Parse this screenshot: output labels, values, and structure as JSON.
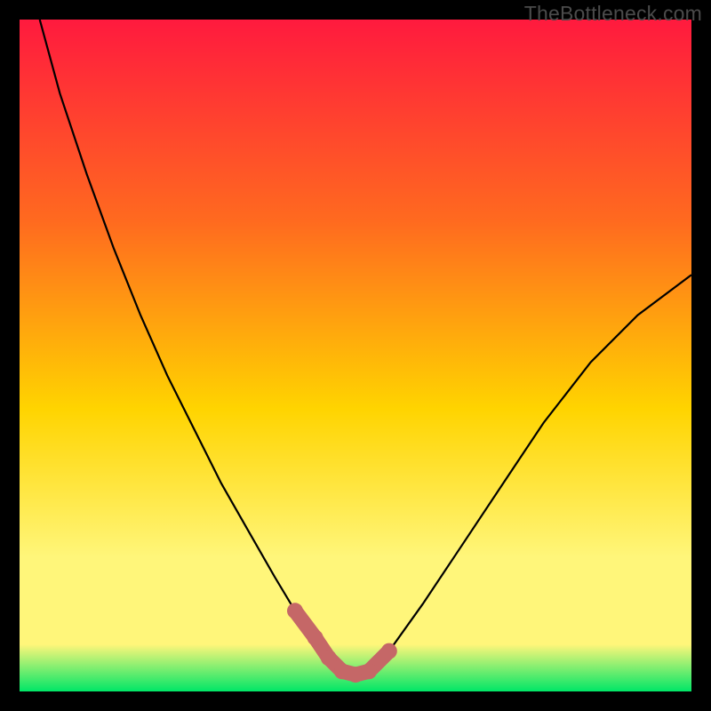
{
  "watermark": "TheBottleneck.com",
  "colors": {
    "frame": "#000000",
    "gradient_top": "#ff1a3e",
    "gradient_mid1": "#ff6a1f",
    "gradient_mid2": "#ffd400",
    "gradient_mid3": "#fff67a",
    "gradient_bottom": "#00e667",
    "curve": "#000000",
    "marker": "#c56767"
  },
  "chart_data": {
    "type": "line",
    "title": "",
    "xlabel": "",
    "ylabel": "",
    "xlim": [
      0,
      100
    ],
    "ylim": [
      0,
      100
    ],
    "series": [
      {
        "name": "bottleneck-curve",
        "x": [
          3,
          6,
          10,
          14,
          18,
          22,
          26,
          30,
          34,
          38,
          41,
          44,
          46,
          48,
          50,
          52,
          55,
          60,
          66,
          72,
          78,
          85,
          92,
          100
        ],
        "y": [
          100,
          89,
          77,
          66,
          56,
          47,
          39,
          31,
          24,
          17,
          12,
          8,
          5,
          3,
          2.5,
          3,
          6,
          13,
          22,
          31,
          40,
          49,
          56,
          62
        ]
      }
    ],
    "markers": {
      "name": "highlight-segment",
      "x": [
        41,
        44,
        46,
        48,
        50,
        52,
        55
      ],
      "y": [
        12,
        8,
        5,
        3,
        2.5,
        3,
        6
      ]
    }
  }
}
